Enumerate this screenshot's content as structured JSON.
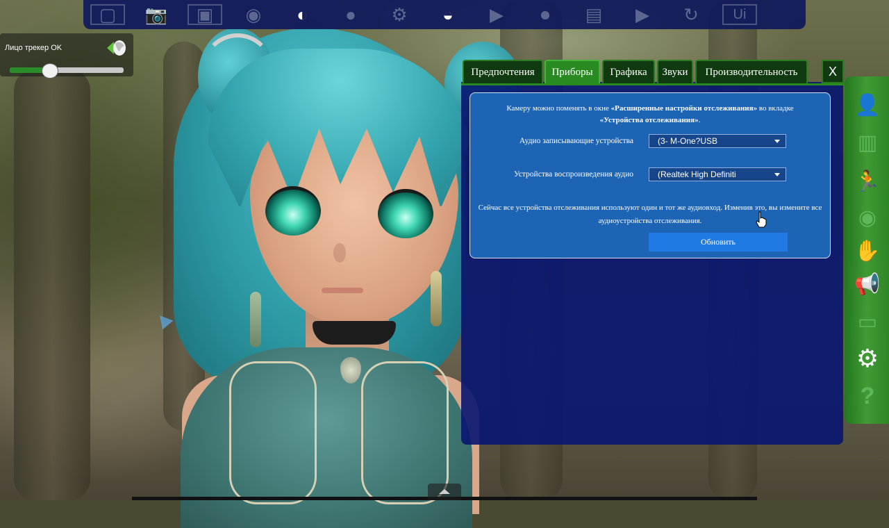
{
  "toolbar": {
    "items": [
      {
        "name": "fullscreen-icon",
        "glyph": "▢",
        "active": false
      },
      {
        "name": "camera-icon",
        "glyph": "📷",
        "active": false
      },
      {
        "name": "background-image-icon",
        "glyph": "▣",
        "active": false
      },
      {
        "name": "broadcast-icon",
        "glyph": "◉",
        "active": false
      },
      {
        "name": "face-tracking-icon",
        "glyph": "◐",
        "active": true
      },
      {
        "name": "avatar-icon",
        "glyph": "●",
        "active": false
      },
      {
        "name": "person-gear-icon",
        "glyph": "⚙",
        "active": false
      },
      {
        "name": "lips-icon",
        "glyph": "◒",
        "active": true
      },
      {
        "name": "play-icon",
        "glyph": "▶",
        "active": false
      },
      {
        "name": "record-icon",
        "glyph": "⏺",
        "active": false
      },
      {
        "name": "film-icon",
        "glyph": "▤",
        "active": false
      },
      {
        "name": "video-icon",
        "glyph": "▶",
        "active": false
      },
      {
        "name": "reset-icon",
        "glyph": "↻",
        "active": false
      },
      {
        "name": "ui-toggle-icon",
        "glyph": "Ui",
        "active": false
      }
    ]
  },
  "tracker": {
    "status_label": "Лицо трекер OK",
    "slider_value": 0.35
  },
  "tabs": [
    {
      "label": "Предпочтения",
      "active": false
    },
    {
      "label": "Приборы",
      "active": true
    },
    {
      "label": "Графика",
      "active": false
    },
    {
      "label": "Звуки",
      "active": false
    },
    {
      "label": "Производительность",
      "active": false
    }
  ],
  "close_label": "X",
  "devices": {
    "info_prefix": "Камеру можно поменять в окне ",
    "info_bold1": "«Расширенные настройки отслеживания»",
    "info_middle": " во вкладке ",
    "info_bold2": "«Устройства отслеживания»",
    "info_suffix": ".",
    "audio_input_label": "Аудио записывающие устройства",
    "audio_input_value": "(3- M-One?USB",
    "audio_output_label": "Устройства воспроизведения аудио",
    "audio_output_value": "(Realtek High Definiti",
    "note": "Сейчас все устройства отслеживания используют один и тот же аудиовход. Изменив это, вы измените все аудиоустройства отслеживания.",
    "refresh_label": "Обновить"
  },
  "sidebar": {
    "items": [
      {
        "name": "avatar-sidebar-icon",
        "glyph": "👤",
        "active": false
      },
      {
        "name": "scene-sidebar-icon",
        "glyph": "▥",
        "active": false
      },
      {
        "name": "motion-sidebar-icon",
        "glyph": "🏃",
        "active": false
      },
      {
        "name": "eye-tracking-sidebar-icon",
        "glyph": "◉",
        "active": false
      },
      {
        "name": "hand-sidebar-icon",
        "glyph": "✋",
        "active": false
      },
      {
        "name": "megaphone-sidebar-icon",
        "glyph": "📢",
        "active": false
      },
      {
        "name": "editor-sidebar-icon",
        "glyph": "▭",
        "active": false
      },
      {
        "name": "settings-gear-icon",
        "glyph": "⚙",
        "active": true
      },
      {
        "name": "help-icon",
        "glyph": "?",
        "active": false
      }
    ]
  }
}
